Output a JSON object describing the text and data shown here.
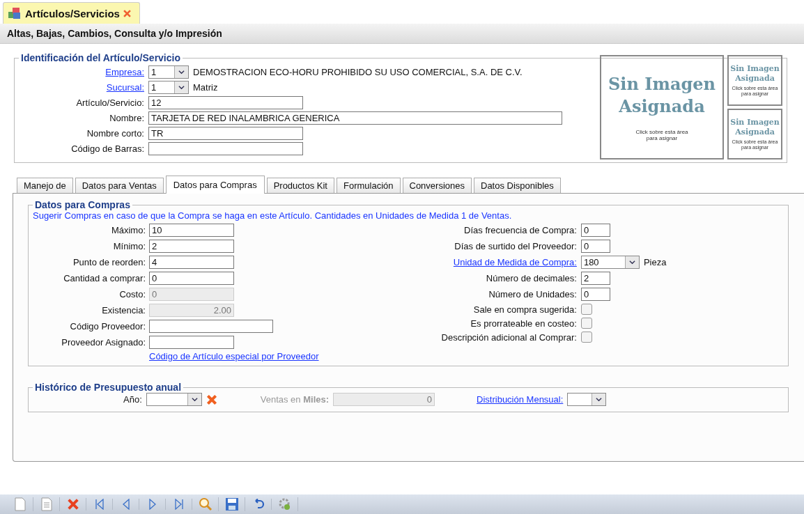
{
  "doc_tab": {
    "title": "Artículos/Servicios"
  },
  "subtitle": "Altas, Bajas, Cambios, Consulta y/o Impresión",
  "identification": {
    "legend": "Identificación del Artículo/Servicio",
    "fields": [
      {
        "kind": "link-combo",
        "label": "Empresa:",
        "value": "1",
        "text": "DEMOSTRACION ECO-HORU PROHIBIDO SU USO COMERCIAL, S.A. DE C.V."
      },
      {
        "kind": "link-combo",
        "label": "Sucursal:",
        "value": "1",
        "text": "Matriz"
      },
      {
        "kind": "input",
        "label": "Artículo/Servicio:",
        "value": "12"
      },
      {
        "kind": "wide",
        "label": "Nombre:",
        "value": "TARJETA DE RED INALAMBRICA GENERICA"
      },
      {
        "kind": "input",
        "label": "Nombre corto:",
        "value": "TR"
      },
      {
        "kind": "input",
        "label": "Código de Barras:"
      }
    ],
    "images": [
      {
        "title": "Sin Imagen Asignada",
        "hint": "Click sobre esta área para asignar"
      },
      {
        "title": "Sin Imagen Asignada",
        "hint": "Click sobre esta área para asignar"
      },
      {
        "title": "Sin Imagen Asignada",
        "hint": "Click sobre esta área para asignar"
      }
    ]
  },
  "tabs": [
    {
      "label": "Manejo de",
      "selected": false
    },
    {
      "label": "Datos para Ventas",
      "selected": false
    },
    {
      "label": "Datos para Compras",
      "selected": true
    },
    {
      "label": "Productos Kit",
      "selected": false
    },
    {
      "label": "Formulación",
      "selected": false
    },
    {
      "label": "Conversiones",
      "selected": false
    },
    {
      "label": "Datos Disponibles",
      "selected": false
    }
  ],
  "compras": {
    "legend": "Datos para Compras",
    "note": "Sugerir Compras en caso de que la Compra se haga en este Artículo. Cantidades en Unidades de Medida 1 de Ventas.",
    "left": [
      {
        "kind": "input",
        "label": "Máximo:",
        "value": "10"
      },
      {
        "kind": "input",
        "label": "Mínimo:",
        "value": "2"
      },
      {
        "kind": "input",
        "label": "Punto de reorden:",
        "value": "4"
      },
      {
        "kind": "input",
        "label": "Cantidad a comprar:",
        "value": "0"
      },
      {
        "kind": "disabled",
        "label": "Costo:",
        "value": "0"
      },
      {
        "kind": "disabled-right",
        "label": "Existencia:",
        "value": "2.00"
      },
      {
        "kind": "wide",
        "label": "Código Proveedor:"
      },
      {
        "kind": "input",
        "label": "Proveedor Asignado:"
      }
    ],
    "link": "Código de Artículo especial por Proveedor",
    "right": [
      {
        "kind": "input",
        "label": "Días frecuencia de Compra:",
        "value": "0"
      },
      {
        "kind": "input",
        "label": "Días de surtido del Proveedor:",
        "value": "0"
      },
      {
        "kind": "link-combo",
        "label": "Unidad de Medida de Compra:",
        "value": "180",
        "text": "Pieza"
      },
      {
        "kind": "input",
        "label": "Número de decimales:",
        "value": "2"
      },
      {
        "kind": "input",
        "label": "Número de Unidades:",
        "value": "0"
      },
      {
        "kind": "checkbox",
        "label": "Sale en compra sugerida:",
        "checked": false
      },
      {
        "kind": "checkbox",
        "label": "Es prorrateable en costeo:",
        "checked": false
      },
      {
        "kind": "checkbox",
        "label": "Descripción adicional al Comprar:",
        "checked": false
      }
    ]
  },
  "historico": {
    "legend": "Histórico de Presupuesto anual",
    "year_label": "Año:",
    "sales_label": "Ventas en **Miles:**",
    "sales_value": "0",
    "distribution_label": "Distribución Mensual:"
  },
  "toolbar": [
    {
      "kind": "new"
    },
    {
      "kind": "doc"
    },
    {
      "kind": "delete"
    },
    {
      "kind": "first"
    },
    {
      "kind": "prev"
    },
    {
      "kind": "next"
    },
    {
      "kind": "last"
    },
    {
      "kind": "search"
    },
    {
      "kind": "save"
    },
    {
      "kind": "undo"
    },
    {
      "kind": "gear"
    }
  ]
}
